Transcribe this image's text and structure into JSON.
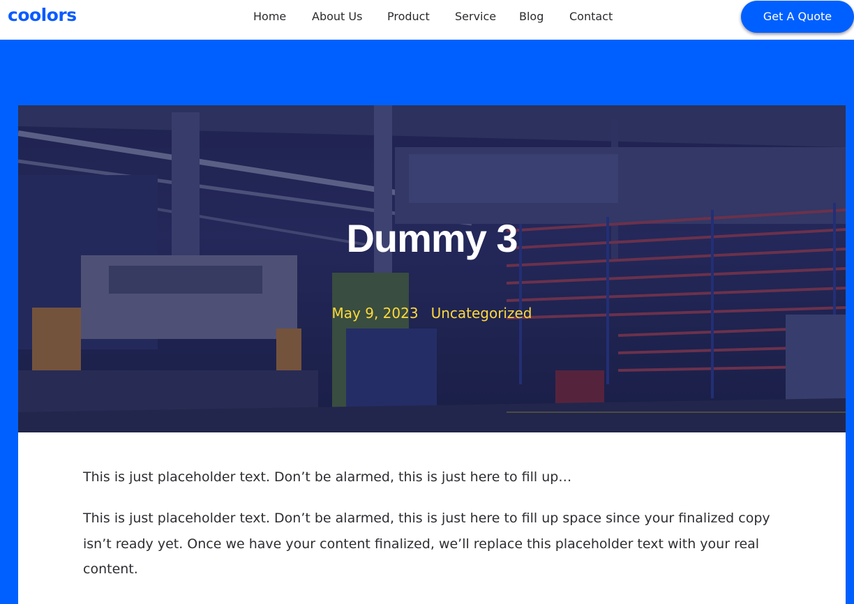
{
  "header": {
    "logo_text": "coolors",
    "nav": [
      "Home",
      "About Us",
      "Product",
      "Service",
      "Blog",
      "Contact"
    ],
    "cta_label": "Get A Quote"
  },
  "post": {
    "title": "Dummy 3",
    "date": "May 9, 2023",
    "category": "Uncategorized",
    "paragraphs": [
      "This is just placeholder text. Don’t be alarmed, this is just here to fill up…",
      "This is just placeholder text. Don’t be alarmed, this is just here to fill up space since your finalized copy isn’t ready yet. Once we have your content finalized, we’ll replace this placeholder text with your real content."
    ]
  },
  "colors": {
    "brand": "#0060ff",
    "meta": "#ffd93b",
    "text": "#2e2e33"
  }
}
